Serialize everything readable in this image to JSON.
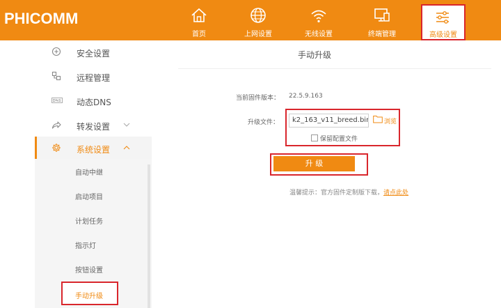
{
  "brand": {
    "logo_text": "PHICOMM",
    "accent": "#f08a12",
    "highlight": "#d9262c"
  },
  "top_nav": [
    {
      "label": "首页",
      "icon": "home-icon"
    },
    {
      "label": "上网设置",
      "icon": "globe-icon"
    },
    {
      "label": "无线设置",
      "icon": "wifi-icon"
    },
    {
      "label": "终端管理",
      "icon": "devices-icon"
    },
    {
      "label": "高级设置",
      "icon": "sliders-icon",
      "active": true
    }
  ],
  "sidebar": {
    "items": [
      {
        "label": "安全设置",
        "icon": "plus-circle-icon"
      },
      {
        "label": "远程管理",
        "icon": "remote-icon"
      },
      {
        "label": "动态DNS",
        "icon": "dns-icon"
      },
      {
        "label": "转发设置",
        "icon": "forward-icon",
        "chevron": "down"
      },
      {
        "label": "系统设置",
        "icon": "gear-icon",
        "chevron": "up",
        "active": true
      }
    ],
    "sub_items": [
      "自动中继",
      "启动项目",
      "计划任务",
      "指示灯",
      "按钮设置",
      "手动升级"
    ],
    "active_sub": "手动升级"
  },
  "main": {
    "title": "手动升级",
    "firmware_label": "当前固件版本：",
    "firmware_version": "22.5.9.163",
    "upgrade_file_label": "升级文件：",
    "upgrade_file_value": "k2_163_v11_breed.bin",
    "browse_label": "浏览",
    "keep_config_label": "保留配置文件",
    "upgrade_button": "升 级",
    "tip_text": "温馨提示：官方固件定制版下载，",
    "tip_link": "请点此处"
  }
}
